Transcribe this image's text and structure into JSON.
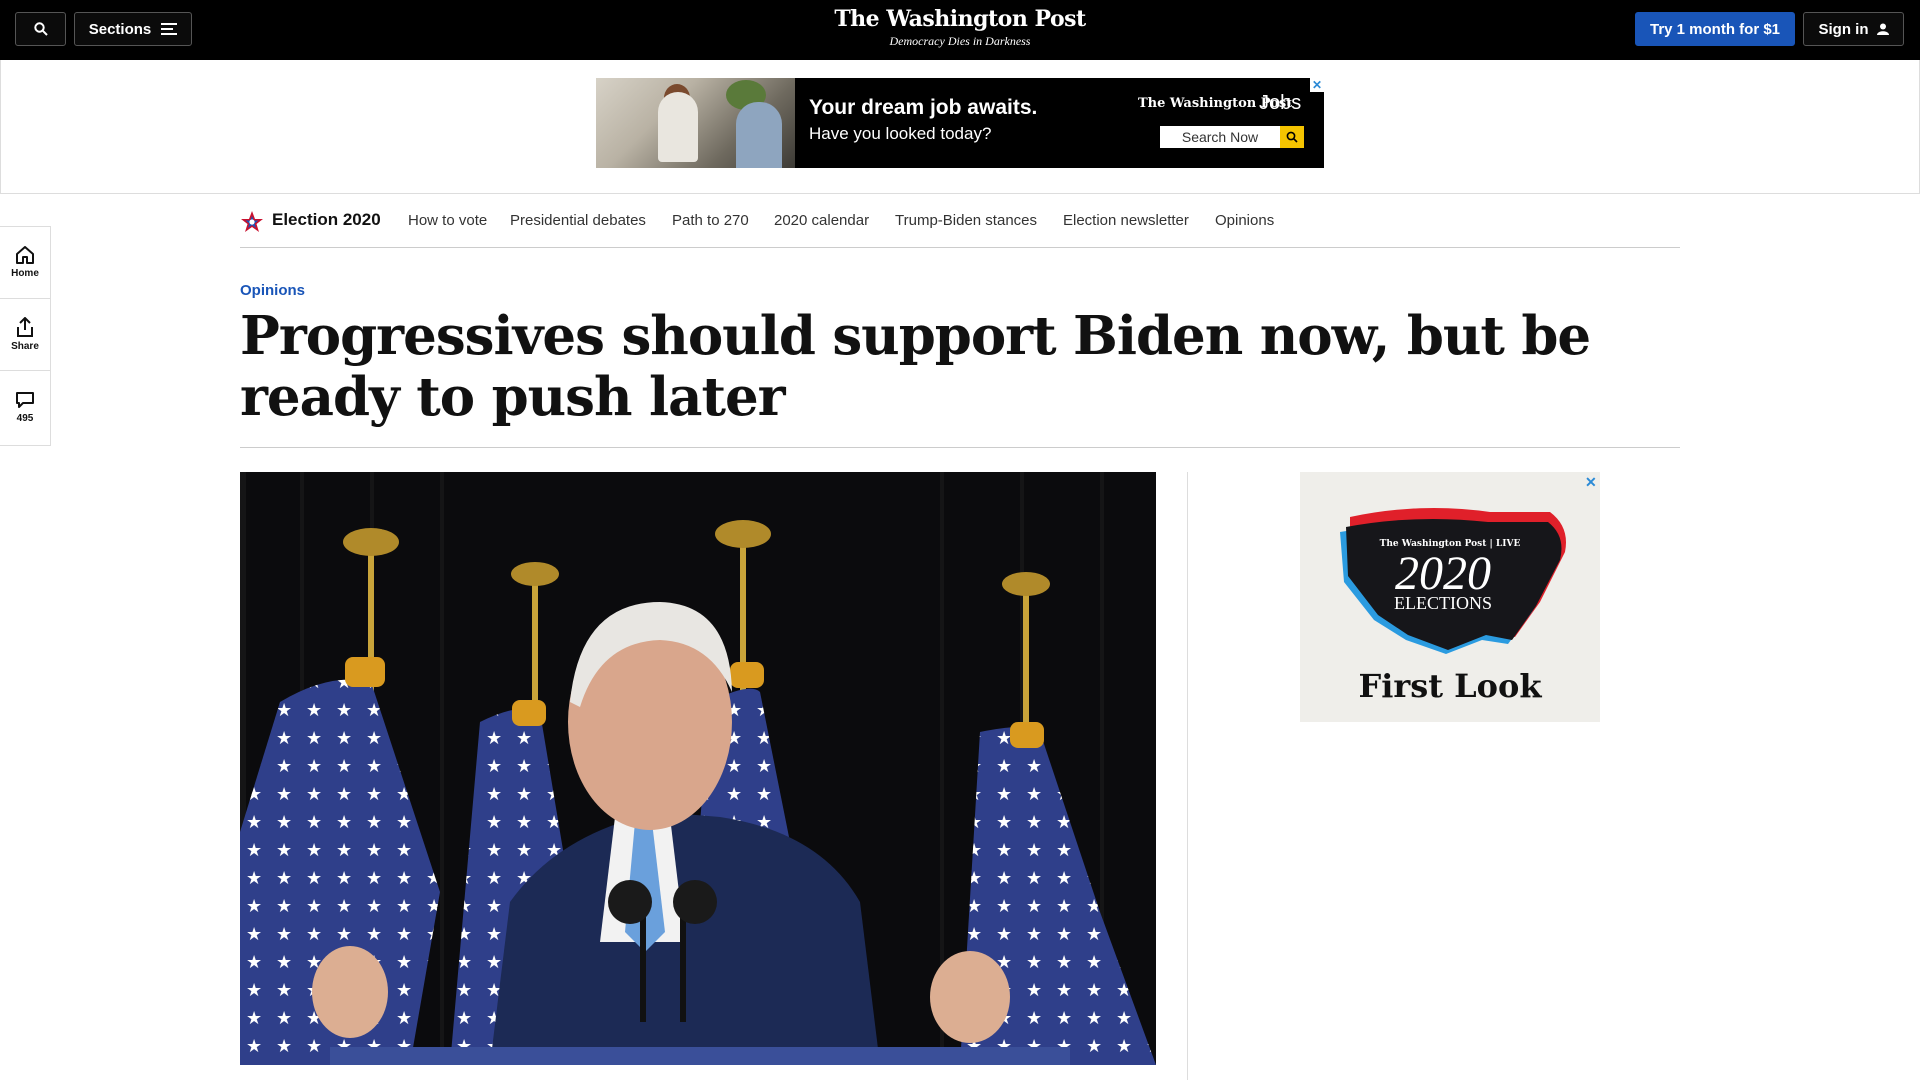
{
  "topbar": {
    "sections_label": "Sections",
    "masthead_logo": "The Washington Post",
    "masthead_tagline": "Democracy Dies in Darkness",
    "subscribe_label": "Try 1 month for $1",
    "signin_label": "Sign in",
    "accent_color": "#1955b8"
  },
  "ad_banner": {
    "headline": "Your dream job awaits.",
    "subline": "Have you looked today?",
    "brand": "The Washington Post",
    "brand_product": "Jobs",
    "search_label": "Search Now",
    "close_label": "✕"
  },
  "election_nav": {
    "brand": "Election 2020",
    "items": [
      "How to vote",
      "Presidential debates",
      "Path to 270",
      "2020 calendar",
      "Trump-Biden stances",
      "Election newsletter",
      "Opinions"
    ]
  },
  "rail": {
    "home_label": "Home",
    "share_label": "Share",
    "comments_count": "495"
  },
  "article": {
    "kicker": "Opinions",
    "headline": "Progressives should support Biden now, but be ready to push later"
  },
  "side_ad": {
    "brand": "The Washington Post | LIVE",
    "year": "2020",
    "title": "ELECTIONS",
    "tagline": "First Look",
    "close_label": "✕"
  }
}
